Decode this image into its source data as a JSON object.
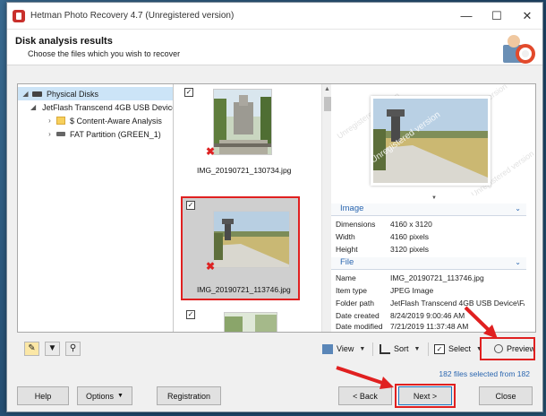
{
  "window": {
    "title": "Hetman Photo Recovery 4.7 (Unregistered version)",
    "controls": {
      "minimize": "—",
      "maximize": "☐",
      "close": "✕"
    }
  },
  "header": {
    "title": "Disk analysis results",
    "subtitle": "Choose the files which you wish to recover"
  },
  "tree": {
    "items": [
      {
        "label": "Physical Disks",
        "icon": "drive-icon",
        "expander": "◢"
      },
      {
        "label": "JetFlash Transcend 4GB USB Device",
        "icon": "usb-drive-icon",
        "expander": "◢"
      },
      {
        "label": "$ Content-Aware Analysis",
        "icon": "folder-icon",
        "expander": "›"
      },
      {
        "label": "FAT Partition (GREEN_1)",
        "icon": "partition-icon",
        "expander": "›"
      }
    ]
  },
  "thumbnails": [
    {
      "name": "IMG_20190721_130734.jpg",
      "checked": true,
      "selected": false
    },
    {
      "name": "IMG_20190721_113746.jpg",
      "checked": true,
      "selected": true
    },
    {
      "name": "",
      "checked": true,
      "selected": false
    }
  ],
  "preview": {
    "watermark": "Unregistered version",
    "image_section": {
      "title": "Image",
      "rows": [
        {
          "label": "Dimensions",
          "value": "4160 x 3120"
        },
        {
          "label": "Width",
          "value": "4160 pixels"
        },
        {
          "label": "Height",
          "value": "3120 pixels"
        }
      ]
    },
    "file_section": {
      "title": "File",
      "rows": [
        {
          "label": "Name",
          "value": "IMG_20190721_113746.jpg"
        },
        {
          "label": "Item type",
          "value": "JPEG Image"
        },
        {
          "label": "Folder path",
          "value": "JetFlash Transcend 4GB USB Device\\FA..."
        },
        {
          "label": "Date created",
          "value": "8/24/2019 9:00:46 AM"
        },
        {
          "label": "Date modified",
          "value": "7/21/2019 11:37:48 AM"
        }
      ]
    }
  },
  "toolbar": {
    "view_label": "View",
    "sort_label": "Sort",
    "select_label": "Select",
    "preview_label": "Preview"
  },
  "status": {
    "text": "182 files selected from 182"
  },
  "buttons": {
    "help": "Help",
    "options": "Options",
    "registration": "Registration",
    "back": "< Back",
    "next": "Next >",
    "close": "Close"
  },
  "colors": {
    "accent": "#2a66b0",
    "highlight": "#e02020",
    "delete_mark": "#d22222"
  }
}
